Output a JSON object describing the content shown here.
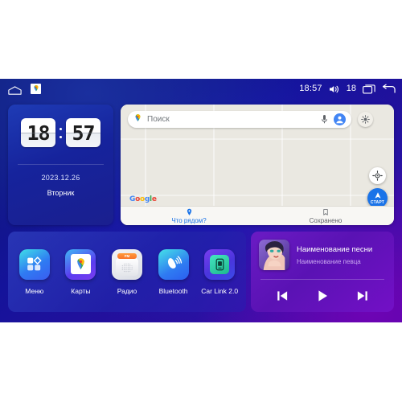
{
  "statusbar": {
    "home_icon": "home-icon",
    "app_icon": "google-maps-icon",
    "time": "18:57",
    "volume_icon": "speaker-icon",
    "volume_level": "18",
    "recents_icon": "recents-icon",
    "back_icon": "back-icon"
  },
  "clock_widget": {
    "hours": "18",
    "minutes": "57",
    "date": "2023.12.26",
    "weekday": "Вторник"
  },
  "map_widget": {
    "search": {
      "placeholder": "Поиск",
      "pin_icon": "google-maps-pin-icon",
      "mic_icon": "microphone-icon",
      "avatar_icon": "account-avatar-icon"
    },
    "layers_icon": "map-layers-icon",
    "locate_icon": "my-location-icon",
    "start_button": {
      "label": "СТАРТ",
      "icon": "navigation-arrow-icon"
    },
    "attribution": "Google",
    "tabs": [
      {
        "label": "Что рядом?",
        "icon": "location-pin-icon",
        "active": true
      },
      {
        "label": "Сохранено",
        "icon": "bookmark-icon",
        "active": false
      }
    ]
  },
  "app_dock": {
    "apps": [
      {
        "label": "Меню",
        "icon": "apps-grid-icon"
      },
      {
        "label": "Карты",
        "icon": "google-maps-icon"
      },
      {
        "label": "Радио",
        "icon": "radio-icon",
        "band": "FM"
      },
      {
        "label": "Bluetooth",
        "icon": "bluetooth-phone-icon"
      },
      {
        "label": "Car Link 2.0",
        "icon": "car-link-icon"
      }
    ]
  },
  "music_widget": {
    "album_art_icon": "album-art-portrait",
    "title": "Наименование песни",
    "artist": "Наименование певца",
    "controls": [
      {
        "name": "previous-track-button",
        "icon": "skip-previous-icon"
      },
      {
        "name": "play-button",
        "icon": "play-icon"
      },
      {
        "name": "next-track-button",
        "icon": "skip-next-icon"
      }
    ]
  },
  "colors": {
    "accent_blue": "#1a73e8",
    "widget_blue": "#1e3bb5",
    "music_purple": "#6a1bc4",
    "map_bg": "#eae7e0"
  }
}
